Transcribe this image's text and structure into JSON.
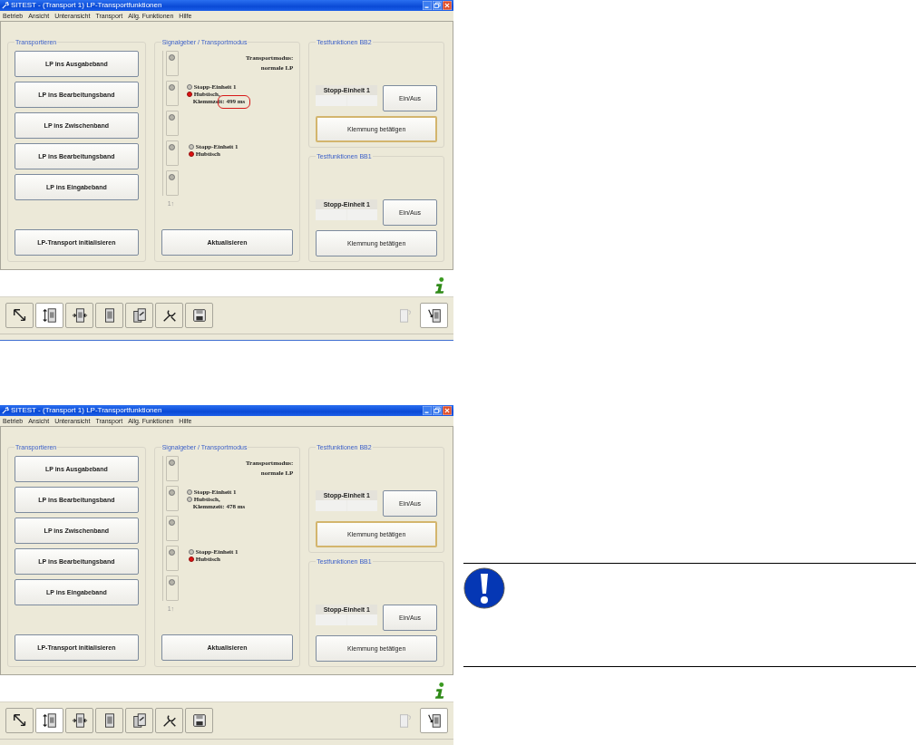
{
  "screens": [
    {
      "window": {
        "title": "SITEST - (Transport 1) LP-Transportfunktionen"
      },
      "menu": [
        "Betrieb",
        "Ansicht",
        "Unteransicht",
        "Transport",
        "Allg. Funktionen",
        "Hilfe"
      ],
      "transport": {
        "title": "Transportieren",
        "buttons": [
          "LP ins Ausgabeband",
          "LP ins Bearbeitungsband",
          "LP ins Zwischenband",
          "LP ins Bearbeitungsband",
          "LP ins Eingabeband"
        ],
        "init_button": "LP-Transport initialisieren"
      },
      "signal": {
        "title": "Signalgeber / Transportmodus",
        "slots": [
          {
            "kind": "mode",
            "lines": [
              "Transportmodus:",
              "normale LP"
            ]
          },
          {
            "kind": "status",
            "lines": [
              {
                "kind": "led",
                "text": "Stopp-Einheit 1",
                "lit": false
              },
              {
                "kind": "led",
                "text": "Hubtisch,",
                "lit": true
              },
              {
                "kind": "note",
                "text": "Klemmzeit: 499 ms",
                "highlighted": true
              }
            ]
          },
          {
            "kind": "empty"
          },
          {
            "kind": "status",
            "lines": [
              {
                "kind": "led",
                "text": "Stopp-Einheit 1",
                "lit": false
              },
              {
                "kind": "led",
                "text": "Hubtisch",
                "lit": true
              }
            ]
          },
          {
            "kind": "empty"
          }
        ],
        "footer": "1↑",
        "button": "Aktualisieren"
      },
      "tests": [
        {
          "title": "Testfunktionen BB2",
          "unit": "Stopp-Einheit 1",
          "toggle_button": "Ein/Aus",
          "clamp_button": {
            "label": "Klemmung betätigen",
            "focused": true
          }
        },
        {
          "title": "Testfunktionen BB1",
          "unit": "Stopp-Einheit 1",
          "toggle_button": "Ein/Aus",
          "clamp_button": {
            "label": "Klemmung betätigen",
            "focused": false
          }
        }
      ],
      "toolbar": {
        "left": [
          {
            "selected": false
          },
          {
            "selected": true
          },
          {
            "selected": false
          },
          {
            "selected": false
          },
          {
            "selected": false
          },
          {
            "selected": false
          },
          {
            "selected": false
          }
        ],
        "right": [
          {
            "selected": false,
            "disabled": true
          },
          {
            "selected": true,
            "disabled": false
          }
        ]
      }
    },
    {
      "window": {
        "title": "SITEST - (Transport 1) LP-Transportfunktionen"
      },
      "menu": [
        "Betrieb",
        "Ansicht",
        "Unteransicht",
        "Transport",
        "Allg. Funktionen",
        "Hilfe"
      ],
      "transport": {
        "title": "Transportieren",
        "buttons": [
          "LP ins Ausgabeband",
          "LP ins Bearbeitungsband",
          "LP ins Zwischenband",
          "LP ins Bearbeitungsband",
          "LP ins Eingabeband"
        ],
        "init_button": "LP-Transport initialisieren"
      },
      "signal": {
        "title": "Signalgeber / Transportmodus",
        "slots": [
          {
            "kind": "mode",
            "lines": [
              "Transportmodus:",
              "normale LP"
            ]
          },
          {
            "kind": "status",
            "lines": [
              {
                "kind": "led",
                "text": "Stopp-Einheit 1",
                "lit": false
              },
              {
                "kind": "led",
                "text": "Hubtisch,",
                "lit": false
              },
              {
                "kind": "note",
                "text": "Klemmzeit: 478 ms",
                "highlighted": false
              }
            ]
          },
          {
            "kind": "empty"
          },
          {
            "kind": "status",
            "lines": [
              {
                "kind": "led",
                "text": "Stopp-Einheit 1",
                "lit": false
              },
              {
                "kind": "led",
                "text": "Hubtisch",
                "lit": true
              }
            ]
          },
          {
            "kind": "empty"
          }
        ],
        "footer": "1↑",
        "button": "Aktualisieren"
      },
      "tests": [
        {
          "title": "Testfunktionen BB2",
          "unit": "Stopp-Einheit 1",
          "toggle_button": "Ein/Aus",
          "clamp_button": {
            "label": "Klemmung betätigen",
            "focused": true
          }
        },
        {
          "title": "Testfunktionen BB1",
          "unit": "Stopp-Einheit 1",
          "toggle_button": "Ein/Aus",
          "clamp_button": {
            "label": "Klemmung betätigen",
            "focused": false
          }
        }
      ],
      "toolbar": {
        "left": [
          {
            "selected": false
          },
          {
            "selected": true
          },
          {
            "selected": false
          },
          {
            "selected": false
          },
          {
            "selected": false
          },
          {
            "selected": false
          },
          {
            "selected": false
          }
        ],
        "right": [
          {
            "selected": false,
            "disabled": true
          },
          {
            "selected": true,
            "disabled": false
          }
        ]
      }
    }
  ],
  "notice": {
    "kind": "important"
  }
}
